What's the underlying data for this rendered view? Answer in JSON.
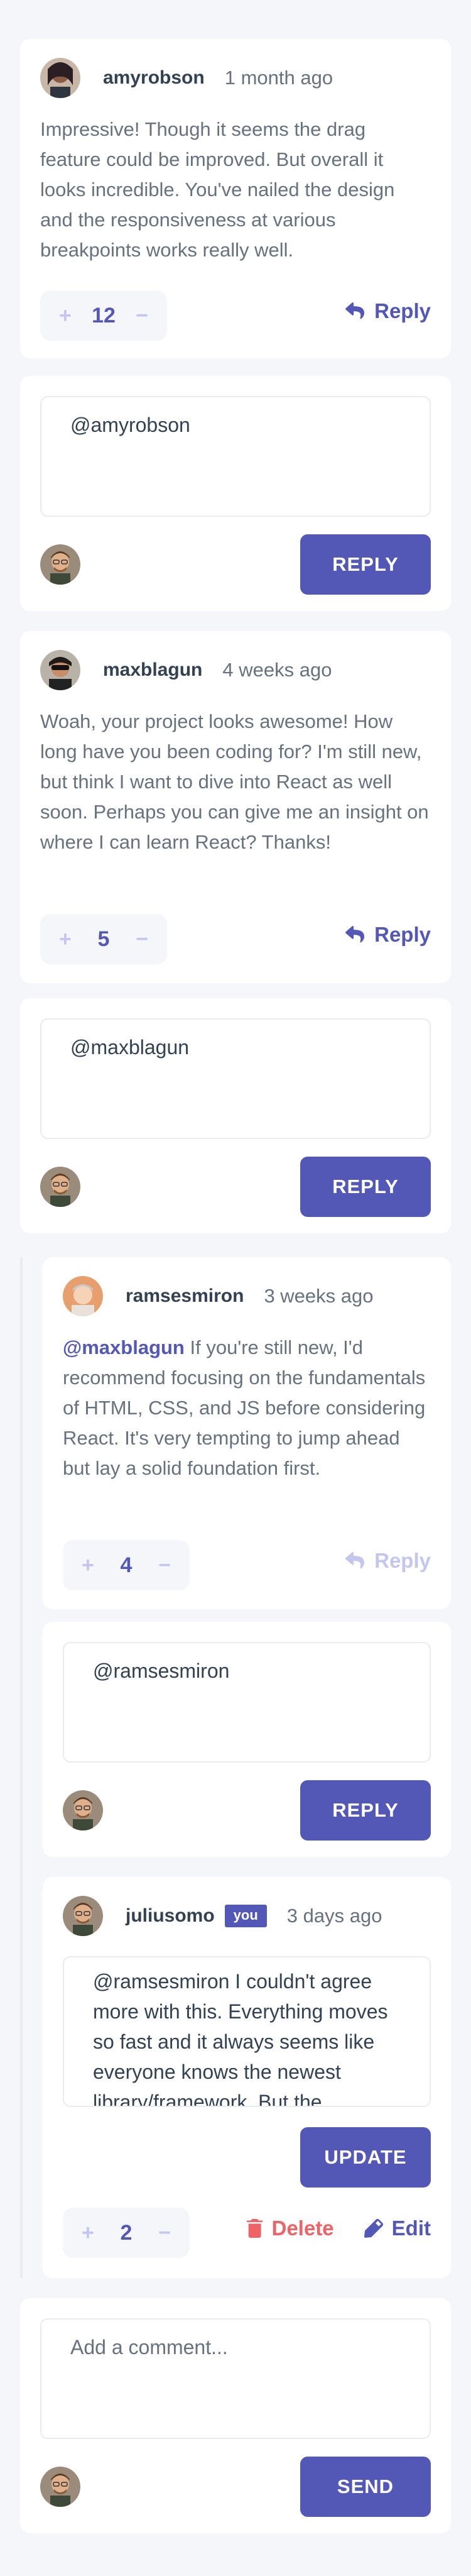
{
  "comments": [
    {
      "user": "amyrobson",
      "time": "1 month ago",
      "text": "Impressive! Though it seems the drag feature could be improved. But overall it looks incredible. You've nailed the design and the responsiveness at various breakpoints works really well.",
      "score": "12",
      "action": "Reply"
    },
    {
      "user": "maxblagun",
      "time": "4 weeks ago",
      "text": "Woah, your project looks awesome! How long have you been coding for? I'm still new, but think I want to dive into React as well soon. Perhaps you can give me an insight on where I can learn React? Thanks!",
      "score": "5",
      "action": "Reply"
    }
  ],
  "reply_boxes": [
    {
      "value": "@amyrobson",
      "button": "REPLY"
    },
    {
      "value": "@maxblagun",
      "button": "REPLY"
    },
    {
      "value": "@ramsesmiron",
      "button": "REPLY"
    }
  ],
  "replies": [
    {
      "user": "ramsesmiron",
      "time": "3 weeks ago",
      "mention": "@maxblagun",
      "text": "If you're still new, I'd recommend focusing on the fundamentals of HTML, CSS, and JS before considering React. It's very tempting to jump ahead but lay a solid foundation first.",
      "score": "4",
      "action": "Reply"
    },
    {
      "user": "juliusomo",
      "badge": "you",
      "time": "3 days ago",
      "edit_value": "@ramsesmiron I couldn't agree more with this. Everything moves so fast and it always seems like everyone knows the newest library/framework. But the fundamentals are what stay constant.",
      "update_button": "UPDATE",
      "score": "2",
      "delete_label": "Delete",
      "edit_label": "Edit"
    }
  ],
  "new_comment": {
    "placeholder": "Add a comment...",
    "button": "SEND"
  },
  "colors": {
    "primary": "#5357b6",
    "primary_light": "#c5c6ef",
    "danger": "#ed6368",
    "heading": "#334253",
    "body": "#67727e",
    "background": "#f5f6fa"
  },
  "icons": {
    "reply": "reply-arrow-icon",
    "delete": "trash-icon",
    "edit": "pencil-icon"
  }
}
